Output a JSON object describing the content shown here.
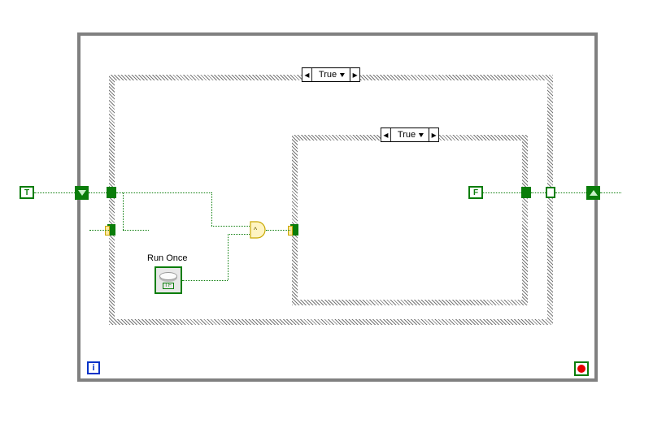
{
  "bool_true_const": "T",
  "bool_false_const": "F",
  "case_outer_label": "True",
  "case_inner_label": "True",
  "run_once_label": "Run Once",
  "run_once_tf": "TF",
  "and_gate_symbol": "∧",
  "iteration_symbol": "i",
  "nav_prev_glyph": "◂",
  "nav_next_glyph": "▸"
}
